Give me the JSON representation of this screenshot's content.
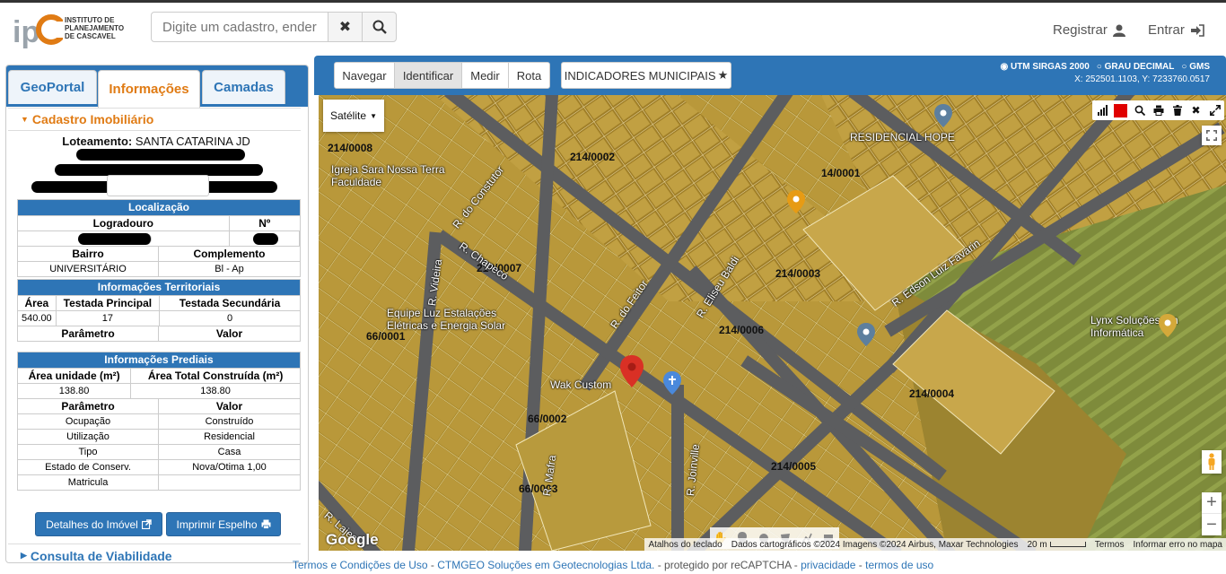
{
  "header": {
    "logo_text_1": "INSTITUTO DE",
    "logo_text_2": "PLANEJAMENTO",
    "logo_text_3": "DE CASCAVEL",
    "search_placeholder": "Digite um cadastro, endereço",
    "clear_icon": "✖",
    "search_icon": "magnifier",
    "register_label": "Registrar",
    "login_label": "Entrar"
  },
  "left_panel": {
    "tabs": [
      {
        "label": "GeoPortal"
      },
      {
        "label": "Informações"
      },
      {
        "label": "Camadas"
      }
    ],
    "section_title": "Cadastro Imobiliário",
    "loteamento_label": "Loteamento:",
    "loteamento_value": "SANTA CATARINA JD",
    "localizacao": {
      "title": "Localização",
      "col1": "Logradouro",
      "col2": "Nº",
      "bairro_label": "Bairro",
      "complemento_label": "Complemento",
      "bairro_value": "UNIVERSITÁRIO",
      "complemento_value": "Bl - Ap"
    },
    "territoriais": {
      "title": "Informações Territoriais",
      "h1": "Área",
      "h2": "Testada Principal",
      "h3": "Testada Secundária",
      "v1": "540.00",
      "v2": "17",
      "v3": "0",
      "p1": "Parâmetro",
      "p2": "Valor"
    },
    "prediais": {
      "title": "Informações Prediais",
      "h1": "Área unidade (m²)",
      "h2": "Área Total Construída (m²)",
      "v1": "138.80",
      "v2": "138.80",
      "p1": "Parâmetro",
      "p2": "Valor",
      "rows": [
        {
          "k": "Ocupação",
          "v": "Construído"
        },
        {
          "k": "Utilização",
          "v": "Residencial"
        },
        {
          "k": "Tipo",
          "v": "Casa"
        },
        {
          "k": "Estado de Conserv.",
          "v": "Nova/Otima 1,00"
        },
        {
          "k": "Matricula",
          "v": ""
        }
      ]
    },
    "details_button": "Detalhes do Imóvel",
    "print_button": "Imprimir Espelho",
    "next_section": "Consulta de Viabilidade"
  },
  "map_toolbar": {
    "tools": [
      "Navegar",
      "Identificar",
      "Medir",
      "Rota"
    ],
    "indicadores": "INDICADORES MUNICIPAIS",
    "proj_options": [
      "UTM SIRGAS 2000",
      "GRAU DECIMAL",
      "GMS"
    ],
    "coords": "X: 252501.1103, Y: 7233760.0517"
  },
  "map": {
    "basemap": "Satélite",
    "labels": [
      "214/0008",
      "214/0002",
      "14/0001",
      "214/0007",
      "214/0003",
      "214/0006",
      "66/0001",
      "66/0002",
      "214/0004",
      "66/0003",
      "214/0005"
    ],
    "streets": [
      "R. do Constutor",
      "R. Chapecó",
      "R. Videira",
      "R. do Feitor",
      "R. Eliseu Baldi",
      "R. Edson Luiz Favarin",
      "R. Mafra",
      "R. Joinville",
      "R. Lajes"
    ],
    "pois": [
      "RESIDENCIAL HOPE",
      "Lynx Soluções em Informática",
      "Wak Custom",
      "Igreja Sara Nossa Terra Faculdade",
      "Equipe Luz Estalações Elétricas e Energia Solar"
    ],
    "attribution": [
      "Atalhos do teclado",
      "Dados cartográficos ©2024 Imagens ©2024 Airbus, Maxar Technologies",
      "20 m",
      "Termos",
      "Informar erro no mapa"
    ],
    "google": "Google"
  },
  "footer": {
    "terms": "Termos e Condições de Uso",
    "sep1": " - ",
    "ctmgeo": "CTMGEO Soluções em Geotecnologias Ltda.",
    "protected": " - protegido por reCAPTCHA - ",
    "privacy": "privacidade",
    "sep2": " - ",
    "tos": "termos de uso"
  },
  "colors": {
    "primary": "#2e75b6",
    "accent": "#e07b14"
  }
}
